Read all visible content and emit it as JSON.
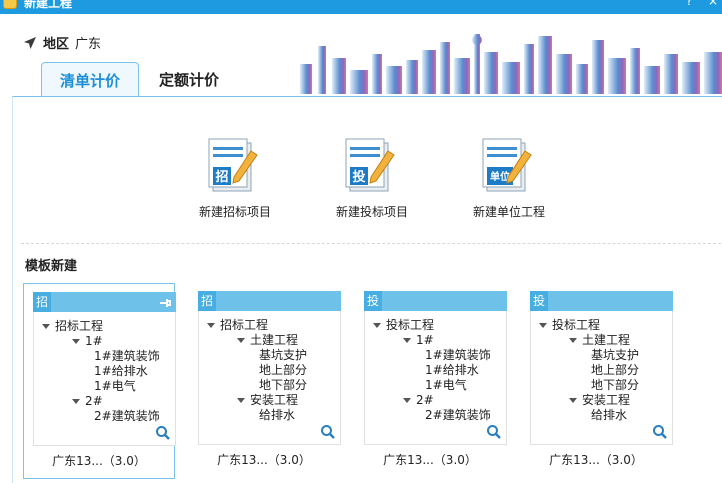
{
  "window": {
    "title": "新建工程",
    "help_label": "?",
    "close_label": "×"
  },
  "region": {
    "label": "地区",
    "value": "广东"
  },
  "tabs": [
    {
      "label": "清单计价",
      "active": true
    },
    {
      "label": "定额计价",
      "active": false
    }
  ],
  "actions": [
    {
      "label": "新建招标项目",
      "badge": "招"
    },
    {
      "label": "新建投标项目",
      "badge": "投"
    },
    {
      "label": "新建单位工程",
      "badge": "单位"
    }
  ],
  "templates_title": "模板新建",
  "templates": [
    {
      "tag": "招",
      "selected": true,
      "footer": "广东13...（3.0）",
      "tree": [
        {
          "label": "招标工程",
          "level": 0,
          "expanded": true
        },
        {
          "label": "1#",
          "level": 1,
          "expanded": true
        },
        {
          "label": "1#建筑装饰",
          "level": 2
        },
        {
          "label": "1#给排水",
          "level": 2
        },
        {
          "label": "1#电气",
          "level": 2
        },
        {
          "label": "2#",
          "level": 1,
          "expanded": true
        },
        {
          "label": "2#建筑装饰",
          "level": 2
        }
      ]
    },
    {
      "tag": "招",
      "selected": false,
      "footer": "广东13...（3.0）",
      "tree": [
        {
          "label": "招标工程",
          "level": 0,
          "expanded": true
        },
        {
          "label": "土建工程",
          "level": 1,
          "expanded": true
        },
        {
          "label": "基坑支护",
          "level": 2
        },
        {
          "label": "地上部分",
          "level": 2
        },
        {
          "label": "地下部分",
          "level": 2
        },
        {
          "label": "安装工程",
          "level": 1,
          "expanded": true
        },
        {
          "label": "给排水",
          "level": 2
        }
      ]
    },
    {
      "tag": "投",
      "selected": false,
      "footer": "广东13...（3.0）",
      "tree": [
        {
          "label": "投标工程",
          "level": 0,
          "expanded": true
        },
        {
          "label": "1#",
          "level": 1,
          "expanded": true
        },
        {
          "label": "1#建筑装饰",
          "level": 2
        },
        {
          "label": "1#给排水",
          "level": 2
        },
        {
          "label": "1#电气",
          "level": 2
        },
        {
          "label": "2#",
          "level": 1,
          "expanded": true
        },
        {
          "label": "2#建筑装饰",
          "level": 2
        }
      ]
    },
    {
      "tag": "投",
      "selected": false,
      "footer": "广东13...（3.0）",
      "tree": [
        {
          "label": "投标工程",
          "level": 0,
          "expanded": true
        },
        {
          "label": "土建工程",
          "level": 1,
          "expanded": true
        },
        {
          "label": "基坑支护",
          "level": 2
        },
        {
          "label": "地上部分",
          "level": 2
        },
        {
          "label": "地下部分",
          "level": 2
        },
        {
          "label": "安装工程",
          "level": 1,
          "expanded": true
        },
        {
          "label": "给排水",
          "level": 2
        }
      ]
    }
  ],
  "colors": {
    "accent": "#1e9be0",
    "card_bar": "#6ec2ea",
    "tab_active_text": "#1e8ed6"
  }
}
